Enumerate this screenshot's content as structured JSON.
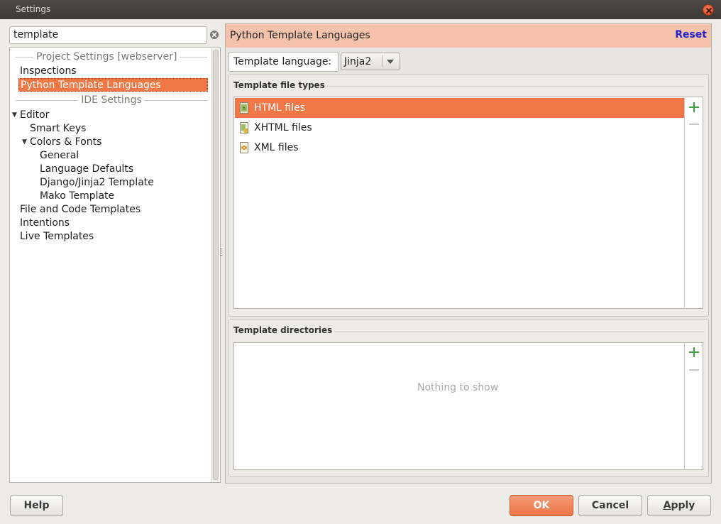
{
  "window": {
    "title": "Settings"
  },
  "search": {
    "value": "template"
  },
  "tree": {
    "project_separator": "Project Settings [webserver]",
    "project_items": [
      "Inspections",
      "Python Template Languages"
    ],
    "ide_separator": "IDE Settings",
    "ide_items": {
      "editor": "Editor",
      "smart_keys": "Smart Keys",
      "colors_fonts": "Colors & Fonts",
      "general": "General",
      "language_defaults": "Language Defaults",
      "django": "Django/Jinja2 Template",
      "mako": "Mako Template",
      "file_code_templates": "File and Code Templates",
      "intentions": "Intentions",
      "live_templates": "Live Templates"
    }
  },
  "panel": {
    "title": "Python Template Languages",
    "reset": "Reset",
    "language_label": "Template language:",
    "language_value": "Jinja2",
    "file_types": {
      "title": "Template file types",
      "items": [
        "HTML files",
        "XHTML files",
        "XML files"
      ]
    },
    "directories": {
      "title": "Template directories",
      "empty": "Nothing to show"
    }
  },
  "buttons": {
    "help": "Help",
    "ok": "OK",
    "cancel": "Cancel",
    "apply_prefix": "A",
    "apply_rest": "pply"
  },
  "colors": {
    "accent": "#f07746",
    "header_bg": "#f4c2aa",
    "link": "#2323c8",
    "add": "#3fa33f"
  }
}
